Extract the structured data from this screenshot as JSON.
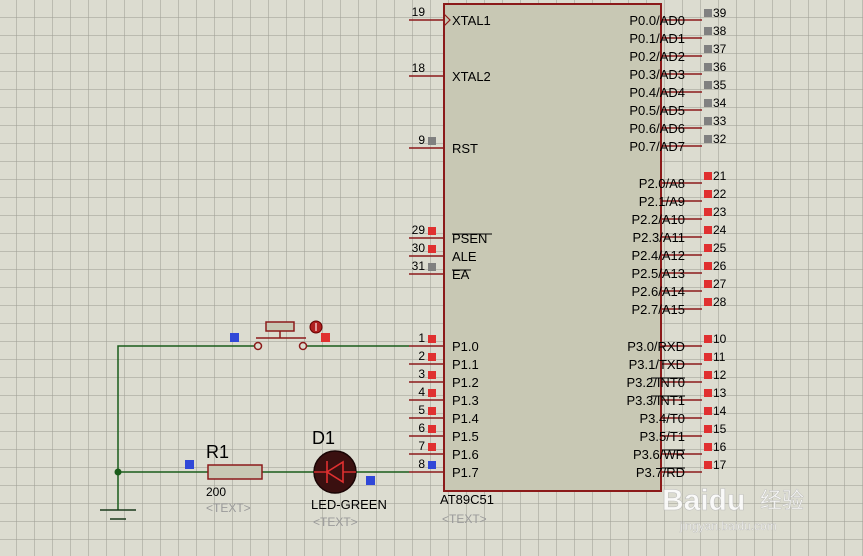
{
  "chip": {
    "part": "AT89C51",
    "text_placeholder": "<TEXT>",
    "left_pins": [
      {
        "num": "19",
        "name": "XTAL1",
        "marker": "none"
      },
      {
        "num": "18",
        "name": "XTAL2",
        "marker": "none"
      },
      {
        "num": "9",
        "name": "RST",
        "marker": "grey"
      },
      {
        "num": "29",
        "name": "PSEN",
        "marker": "red"
      },
      {
        "num": "30",
        "name": "ALE",
        "marker": "red"
      },
      {
        "num": "31",
        "name": "EA",
        "marker": "grey"
      },
      {
        "num": "1",
        "name": "P1.0",
        "marker": "red"
      },
      {
        "num": "2",
        "name": "P1.1",
        "marker": "red"
      },
      {
        "num": "3",
        "name": "P1.2",
        "marker": "red"
      },
      {
        "num": "4",
        "name": "P1.3",
        "marker": "red"
      },
      {
        "num": "5",
        "name": "P1.4",
        "marker": "red"
      },
      {
        "num": "6",
        "name": "P1.5",
        "marker": "red"
      },
      {
        "num": "7",
        "name": "P1.6",
        "marker": "red"
      },
      {
        "num": "8",
        "name": "P1.7",
        "marker": "blue"
      }
    ],
    "right_pins": [
      {
        "num": "39",
        "name": "P0.0/AD0",
        "marker": "grey"
      },
      {
        "num": "38",
        "name": "P0.1/AD1",
        "marker": "grey"
      },
      {
        "num": "37",
        "name": "P0.2/AD2",
        "marker": "grey"
      },
      {
        "num": "36",
        "name": "P0.3/AD3",
        "marker": "grey"
      },
      {
        "num": "35",
        "name": "P0.4/AD4",
        "marker": "grey"
      },
      {
        "num": "34",
        "name": "P0.5/AD5",
        "marker": "grey"
      },
      {
        "num": "33",
        "name": "P0.6/AD6",
        "marker": "grey"
      },
      {
        "num": "32",
        "name": "P0.7/AD7",
        "marker": "grey"
      },
      {
        "num": "21",
        "name": "P2.0/A8",
        "marker": "red"
      },
      {
        "num": "22",
        "name": "P2.1/A9",
        "marker": "red"
      },
      {
        "num": "23",
        "name": "P2.2/A10",
        "marker": "red"
      },
      {
        "num": "24",
        "name": "P2.3/A11",
        "marker": "red"
      },
      {
        "num": "25",
        "name": "P2.4/A12",
        "marker": "red"
      },
      {
        "num": "26",
        "name": "P2.5/A13",
        "marker": "red"
      },
      {
        "num": "27",
        "name": "P2.6/A14",
        "marker": "red"
      },
      {
        "num": "28",
        "name": "P2.7/A15",
        "marker": "red"
      },
      {
        "num": "10",
        "name": "P3.0/RXD",
        "marker": "red"
      },
      {
        "num": "11",
        "name": "P3.1/TXD",
        "marker": "red"
      },
      {
        "num": "12",
        "name": "P3.2/INT0",
        "marker": "red"
      },
      {
        "num": "13",
        "name": "P3.3/INT1",
        "marker": "red"
      },
      {
        "num": "14",
        "name": "P3.4/T0",
        "marker": "red"
      },
      {
        "num": "15",
        "name": "P3.5/T1",
        "marker": "red"
      },
      {
        "num": "16",
        "name": "P3.6/WR",
        "marker": "red"
      },
      {
        "num": "17",
        "name": "P3.7/RD",
        "marker": "red"
      }
    ]
  },
  "resistor": {
    "ref": "R1",
    "value": "200",
    "text_placeholder": "<TEXT>"
  },
  "led": {
    "ref": "D1",
    "part": "LED-GREEN",
    "text_placeholder": "<TEXT>"
  },
  "watermark": {
    "brand": "Baidu",
    "brand2": "经验",
    "url": "jingyan.baidu.com"
  },
  "colors": {
    "background": "#dcdcd0",
    "chip_fill": "#c8c8b4",
    "chip_border": "#8b1a1a",
    "wire": "#1a5c1a",
    "pin_red": "#e03030",
    "pin_grey": "#808080",
    "pin_blue": "#3048d8"
  }
}
